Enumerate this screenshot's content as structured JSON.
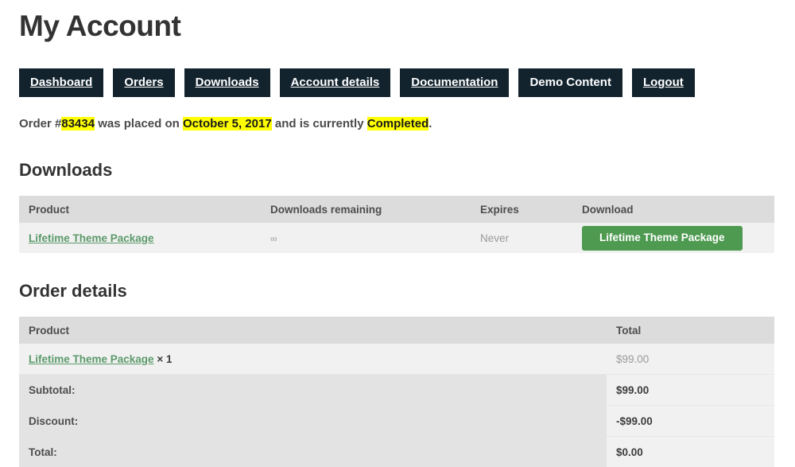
{
  "page": {
    "title": "My Account"
  },
  "nav": {
    "items": [
      {
        "label": "Dashboard",
        "underline": true
      },
      {
        "label": "Orders",
        "underline": true
      },
      {
        "label": "Downloads",
        "underline": true
      },
      {
        "label": "Account details",
        "underline": true
      },
      {
        "label": "Documentation",
        "underline": true
      },
      {
        "label": "Demo Content",
        "underline": false
      },
      {
        "label": "Logout",
        "underline": true
      }
    ]
  },
  "order_status": {
    "prefix": "Order #",
    "order_number": "83434",
    "middle": " was placed on ",
    "date": "October 5, 2017",
    "connector": " and is currently ",
    "status": "Completed",
    "suffix": ".",
    "highlight_color": "#ffff00"
  },
  "downloads": {
    "heading": "Downloads",
    "columns": [
      "Product",
      "Downloads remaining",
      "Expires",
      "Download"
    ],
    "rows": [
      {
        "product": "Lifetime Theme Package",
        "remaining": "∞",
        "expires": "Never",
        "download_label": "Lifetime Theme Package"
      }
    ],
    "button_color": "#4e9a51",
    "link_color": "#5b9a6a"
  },
  "order_details": {
    "heading": "Order details",
    "columns": [
      "Product",
      "Total"
    ],
    "item_rows": [
      {
        "product": "Lifetime Theme Package",
        "quantity": "× 1",
        "total": "$99.00"
      }
    ],
    "summary_rows": [
      {
        "label": "Subtotal:",
        "value": "$99.00"
      },
      {
        "label": "Discount:",
        "value": "-$99.00"
      },
      {
        "label": "Total:",
        "value": "$0.00"
      }
    ]
  }
}
